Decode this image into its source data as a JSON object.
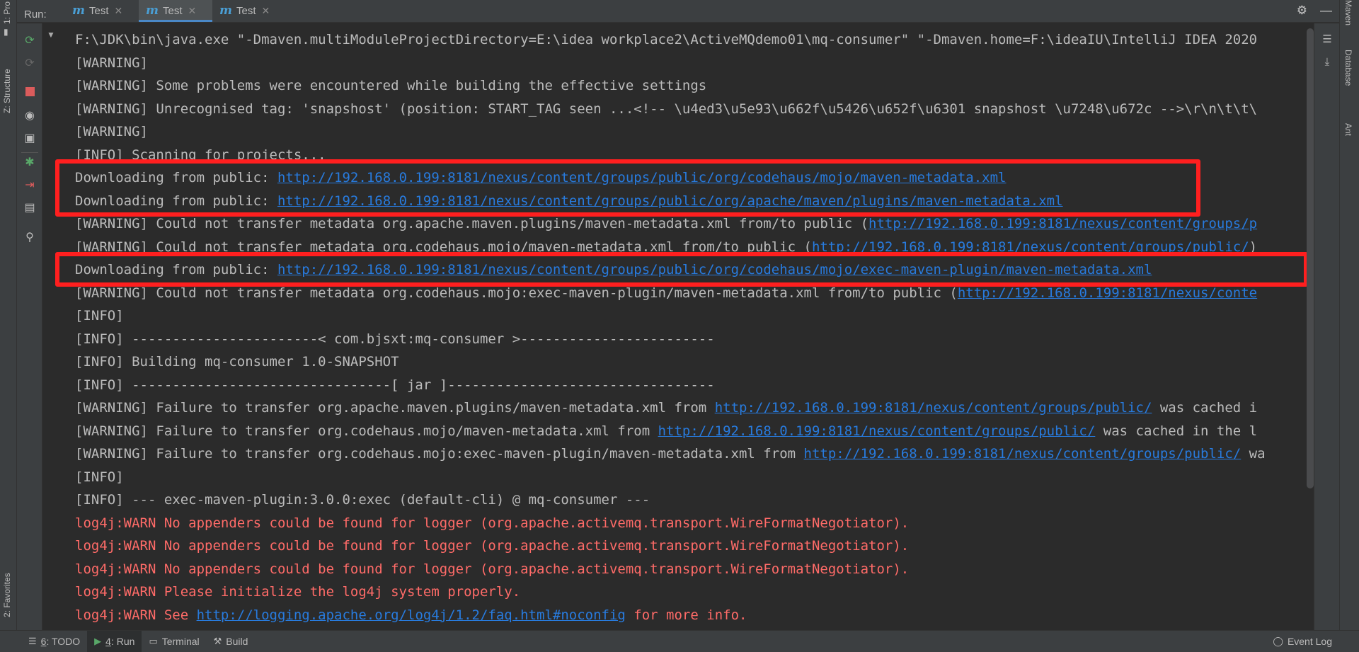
{
  "run_bar": {
    "label": "Run:",
    "tabs": [
      {
        "icon": "m",
        "label": "Test"
      },
      {
        "icon": "m",
        "label": "Test"
      },
      {
        "icon": "m",
        "label": "Test"
      }
    ],
    "active_tab_index": 1
  },
  "left_strip": {
    "project_label": "1: Pro",
    "structure_label": "Z: Structure",
    "favorites_label": "2: Favorites"
  },
  "right_strip": {
    "maven_label": "Maven",
    "database_label": "Database",
    "ant_label": "Ant"
  },
  "console": {
    "lines": [
      {
        "type": "text",
        "text": "F:\\JDK\\bin\\java.exe \"-Dmaven.multiModuleProjectDirectory=E:\\idea workplace2\\ActiveMQdemo01\\mq-consumer\" \"-Dmaven.home=F:\\ideaIU\\IntelliJ IDEA 2020"
      },
      {
        "type": "text",
        "text": "[WARNING]"
      },
      {
        "type": "text",
        "text": "[WARNING] Some problems were encountered while building the effective settings"
      },
      {
        "type": "text",
        "text": "[WARNING] Unrecognised tag: 'snapshost' (position: START_TAG seen ...<!-- \\u4ed3\\u5e93\\u662f\\u5426\\u652f\\u6301 snapshost \\u7248\\u672c -->\\r\\n\\t\\t\\"
      },
      {
        "type": "text",
        "text": "[WARNING]"
      },
      {
        "type": "text",
        "text": "[INFO] Scanning for projects..."
      },
      {
        "type": "link",
        "before": "Downloading from public: ",
        "link": "http://192.168.0.199:8181/nexus/content/groups/public/org/codehaus/mojo/maven-metadata.xml",
        "after": ""
      },
      {
        "type": "link",
        "before": "Downloading from public: ",
        "link": "http://192.168.0.199:8181/nexus/content/groups/public/org/apache/maven/plugins/maven-metadata.xml",
        "after": ""
      },
      {
        "type": "link",
        "before": "[WARNING] Could not transfer metadata org.apache.maven.plugins/maven-metadata.xml from/to public (",
        "link": "http://192.168.0.199:8181/nexus/content/groups/p",
        "after": ""
      },
      {
        "type": "link",
        "before": "[WARNING] Could not transfer metadata org.codehaus.mojo/maven-metadata.xml from/to public (",
        "link": "http://192.168.0.199:8181/nexus/content/groups/public/",
        "after": ")"
      },
      {
        "type": "link",
        "before": "Downloading from public: ",
        "link": "http://192.168.0.199:8181/nexus/content/groups/public/org/codehaus/mojo/exec-maven-plugin/maven-metadata.xml",
        "after": ""
      },
      {
        "type": "link",
        "before": "[WARNING] Could not transfer metadata org.codehaus.mojo:exec-maven-plugin/maven-metadata.xml from/to public (",
        "link": "http://192.168.0.199:8181/nexus/conte",
        "after": ""
      },
      {
        "type": "text",
        "text": "[INFO]"
      },
      {
        "type": "text",
        "text": "[INFO] -----------------------< com.bjsxt:mq-consumer >------------------------"
      },
      {
        "type": "text",
        "text": "[INFO] Building mq-consumer 1.0-SNAPSHOT"
      },
      {
        "type": "text",
        "text": "[INFO] --------------------------------[ jar ]---------------------------------"
      },
      {
        "type": "link",
        "before": "[WARNING] Failure to transfer org.apache.maven.plugins/maven-metadata.xml from ",
        "link": "http://192.168.0.199:8181/nexus/content/groups/public/",
        "after": " was cached i"
      },
      {
        "type": "link",
        "before": "[WARNING] Failure to transfer org.codehaus.mojo/maven-metadata.xml from ",
        "link": "http://192.168.0.199:8181/nexus/content/groups/public/",
        "after": " was cached in the l"
      },
      {
        "type": "link",
        "before": "[WARNING] Failure to transfer org.codehaus.mojo:exec-maven-plugin/maven-metadata.xml from ",
        "link": "http://192.168.0.199:8181/nexus/content/groups/public/",
        "after": " wa"
      },
      {
        "type": "text",
        "text": "[INFO]"
      },
      {
        "type": "text",
        "text": "[INFO] --- exec-maven-plugin:3.0.0:exec (default-cli) @ mq-consumer ---"
      },
      {
        "type": "err",
        "text": "log4j:WARN No appenders could be found for logger (org.apache.activemq.transport.WireFormatNegotiator)."
      },
      {
        "type": "err",
        "text": "log4j:WARN No appenders could be found for logger (org.apache.activemq.transport.WireFormatNegotiator)."
      },
      {
        "type": "err",
        "text": "log4j:WARN No appenders could be found for logger (org.apache.activemq.transport.WireFormatNegotiator)."
      },
      {
        "type": "err",
        "text": "log4j:WARN Please initialize the log4j system properly."
      },
      {
        "type": "errlink",
        "before": "log4j:WARN See ",
        "link": "http://logging.apache.org/log4j/1.2/faq.html#noconfig",
        "after": " for more info."
      }
    ]
  },
  "bottom_bar": {
    "todo_num": "6",
    "todo_label": ": TODO",
    "run_num": "4",
    "run_label": ": Run",
    "terminal_label": "Terminal",
    "build_label": "Build",
    "event_log_label": "Event Log"
  },
  "colors": {
    "background": "#2b2b2b",
    "link": "#287bde",
    "error_text": "#ff6b68",
    "highlight_box": "#ff1f1f",
    "active_tab_underline": "#4a88c7"
  }
}
